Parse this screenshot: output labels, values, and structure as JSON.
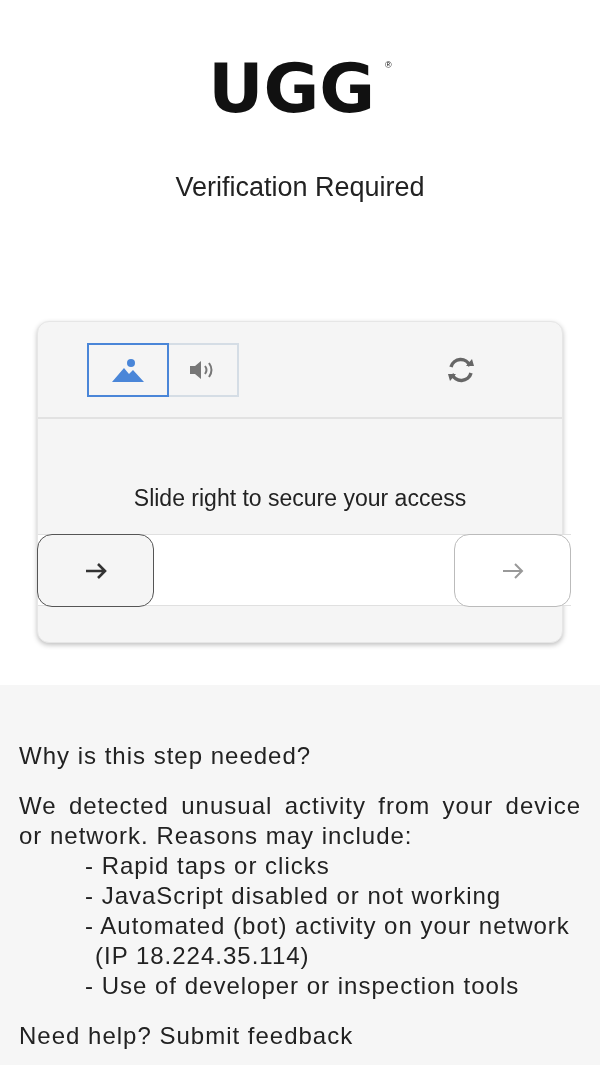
{
  "logo": {
    "text": "UGG",
    "mark": "®"
  },
  "title": "Verification Required",
  "captcha": {
    "modes": [
      {
        "kind": "image",
        "selected": true
      },
      {
        "kind": "audio",
        "selected": false
      }
    ],
    "instruction": "Slide right to secure your access",
    "slider": {
      "level": 0
    }
  },
  "info": {
    "heading": "Why is this step needed?",
    "intro": "We detected unusual activity from your device or network. Reasons may include:",
    "reasons": [
      "- Rapid taps or clicks",
      "- JavaScript disabled or not working",
      "- Automated (bot) activity on your network (IP 18.224.35.114)",
      "- Use of developer or inspection tools"
    ],
    "help": "Need help? Submit feedback"
  }
}
